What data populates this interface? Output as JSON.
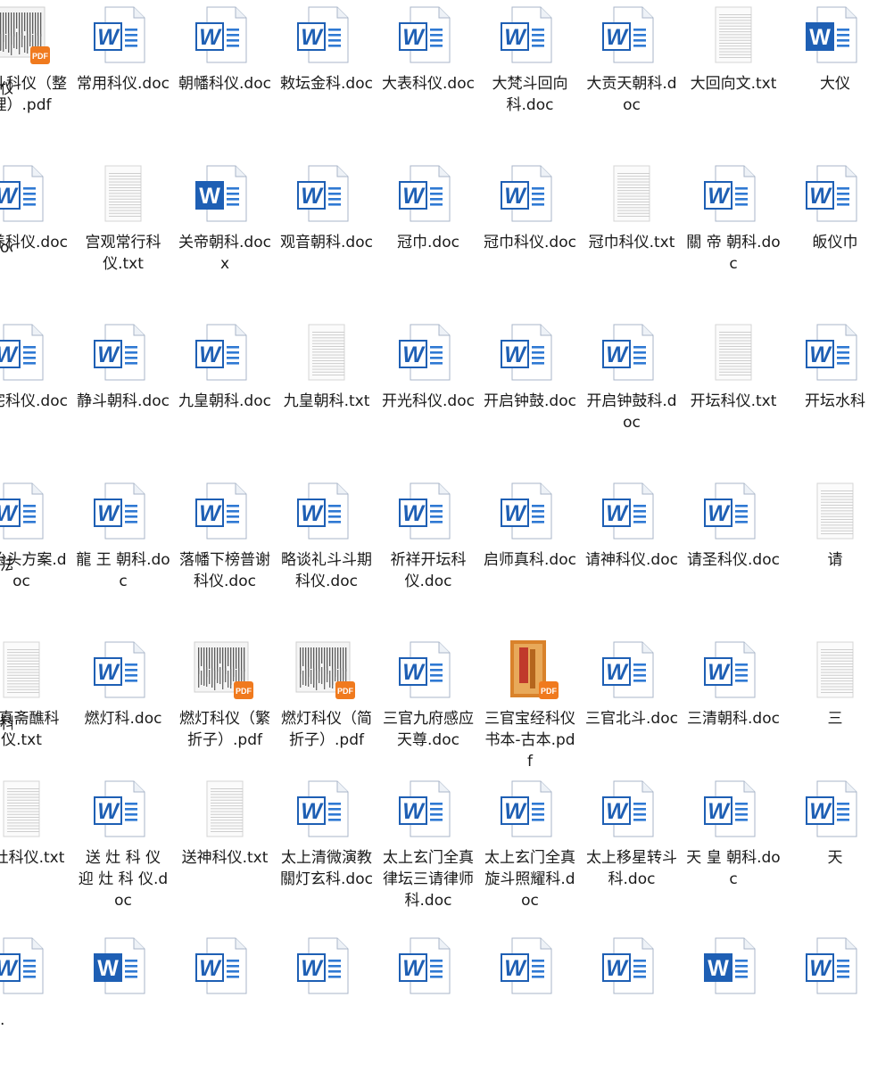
{
  "window": {
    "title": ""
  },
  "colors": {
    "word_blue": "#1e5fb4",
    "word_blue_light": "#2f79d3",
    "pdf_orange": "#f07a1e",
    "label": "#1a1a1a",
    "page_border": "#a9b6c8"
  },
  "rows": [
    [
      {
        "label": "拜斗科仪（整理）.pdf",
        "icon": "pdf-thumb-icon"
      },
      {
        "label": "常用科仪.doc",
        "icon": "word-doc-icon"
      },
      {
        "label": "朝幡科仪.doc",
        "icon": "word-doc-icon"
      },
      {
        "label": "敕坛金科.doc",
        "icon": "word-doc-icon"
      },
      {
        "label": "大表科仪.doc",
        "icon": "word-doc-icon"
      },
      {
        "label": "大梵斗回向科.doc",
        "icon": "word-doc-icon"
      },
      {
        "label": "大贡天朝科.doc",
        "icon": "word-doc-icon"
      },
      {
        "label": "大回向文.txt",
        "icon": "txt-file-icon"
      },
      {
        "label": "大仪",
        "icon": "word-docx-icon"
      }
    ],
    [
      {
        "label": "供养科仪.doc",
        "icon": "word-doc-icon"
      },
      {
        "label": "宫观常行科仪.txt",
        "icon": "txt-file-icon"
      },
      {
        "label": "关帝朝科.docx",
        "icon": "word-docx-icon"
      },
      {
        "label": "观音朝科.doc",
        "icon": "word-doc-icon"
      },
      {
        "label": "冠巾.doc",
        "icon": "word-doc-icon"
      },
      {
        "label": "冠巾科仪.doc",
        "icon": "word-doc-icon"
      },
      {
        "label": "冠巾科仪.txt",
        "icon": "txt-file-icon"
      },
      {
        "label": "關 帝 朝科.doc",
        "icon": "word-doc-icon"
      },
      {
        "label": "皈仪巾",
        "icon": "word-doc-icon"
      }
    ],
    [
      {
        "label": "净宅科仪.doc",
        "icon": "word-doc-icon"
      },
      {
        "label": "静斗朝科.doc",
        "icon": "word-doc-icon"
      },
      {
        "label": "九皇朝科.doc",
        "icon": "word-doc-icon"
      },
      {
        "label": "九皇朝科.txt",
        "icon": "txt-file-icon"
      },
      {
        "label": "开光科仪.doc",
        "icon": "word-doc-icon"
      },
      {
        "label": "开启钟鼓.doc",
        "icon": "word-doc-icon"
      },
      {
        "label": "开启钟鼓科.doc",
        "icon": "word-doc-icon"
      },
      {
        "label": "开坛科仪.txt",
        "icon": "txt-file-icon"
      },
      {
        "label": "开坛水科",
        "icon": "word-doc-icon"
      }
    ],
    [
      {
        "label": "龙抬头方案.doc",
        "icon": "word-doc-icon"
      },
      {
        "label": "龍 王 朝科.doc",
        "icon": "word-doc-icon"
      },
      {
        "label": "落幡下榜普谢科仪.doc",
        "icon": "word-doc-icon"
      },
      {
        "label": "略谈礼斗斗期科仪.doc",
        "icon": "word-doc-icon"
      },
      {
        "label": "祈祥开坛科仪.doc",
        "icon": "word-doc-icon"
      },
      {
        "label": "启师真科.doc",
        "icon": "word-doc-icon"
      },
      {
        "label": "请神科仪.doc",
        "icon": "word-doc-icon"
      },
      {
        "label": "请圣科仪.doc",
        "icon": "word-doc-icon"
      },
      {
        "label": "请",
        "icon": "txt-file-icon"
      }
    ],
    [
      {
        "label": "全真斋醮科仪.txt",
        "icon": "txt-file-icon"
      },
      {
        "label": "燃灯科.doc",
        "icon": "word-doc-icon"
      },
      {
        "label": "燃灯科仪（繁折子）.pdf",
        "icon": "pdf-thumb-icon"
      },
      {
        "label": "燃灯科仪（简折子）.pdf",
        "icon": "pdf-thumb-icon"
      },
      {
        "label": "三官九府感应天尊.doc",
        "icon": "word-doc-icon"
      },
      {
        "label": "三官宝经科仪书本-古本.pdf",
        "icon": "pdf-book-icon"
      },
      {
        "label": "三官北斗.doc",
        "icon": "word-doc-icon"
      },
      {
        "label": "三清朝科.doc",
        "icon": "word-doc-icon"
      },
      {
        "label": "三",
        "icon": "txt-file-icon"
      }
    ],
    [
      {
        "label": "祀灶科仪.txt",
        "icon": "txt-file-icon"
      },
      {
        "label": "送 灶 科 仪 迎 灶 科 仪.doc",
        "icon": "word-doc-icon"
      },
      {
        "label": "送神科仪.txt",
        "icon": "txt-file-icon"
      },
      {
        "label": "太上清微演教關灯玄科.doc",
        "icon": "word-doc-icon"
      },
      {
        "label": "太上玄门全真律坛三请律师科.doc",
        "icon": "word-doc-icon"
      },
      {
        "label": "太上玄门全真旋斗照耀科.doc",
        "icon": "word-doc-icon"
      },
      {
        "label": "太上移星转斗科.doc",
        "icon": "word-doc-icon"
      },
      {
        "label": "天 皇 朝科.doc",
        "icon": "word-doc-icon"
      },
      {
        "label": "天",
        "icon": "word-doc-icon"
      }
    ],
    [
      {
        "label": "",
        "icon": "word-doc-icon"
      },
      {
        "label": "",
        "icon": "word-docx-icon"
      },
      {
        "label": "",
        "icon": "word-doc-icon"
      },
      {
        "label": "",
        "icon": "word-doc-icon"
      },
      {
        "label": "",
        "icon": "word-doc-icon"
      },
      {
        "label": "",
        "icon": "word-doc-icon"
      },
      {
        "label": "",
        "icon": "word-doc-icon"
      },
      {
        "label": "",
        "icon": "word-docx-icon"
      },
      {
        "label": "",
        "icon": "word-doc-icon"
      }
    ]
  ],
  "left_edge_fragments": [
    "仪",
    "oc",
    "",
    "法",
    "科",
    "",
    "."
  ]
}
